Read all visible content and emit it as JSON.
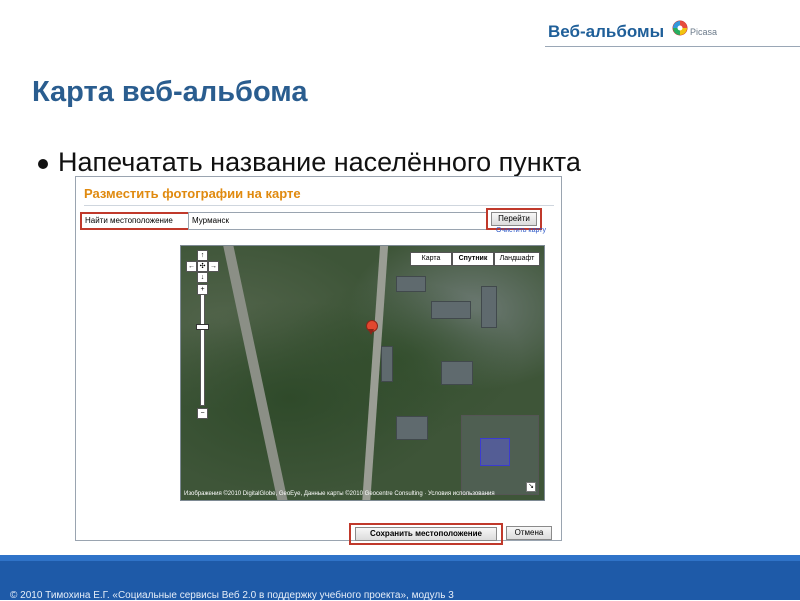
{
  "header": {
    "brand": "Веб-альбомы",
    "brand_logo_text": "Picasa",
    "logo_icon": "picasa-pinwheel-icon"
  },
  "slide": {
    "title": "Карта веб-альбома",
    "bullet": "Напечатать название населённого пункта"
  },
  "dialog": {
    "title": "Разместить фотографии на карте",
    "location_label": "Найти местоположение",
    "location_value": "Мурманск",
    "go_button": "Перейти",
    "clear_link": "Очистить карту",
    "map_types": [
      "Карта",
      "Спутник",
      "Ландшафт"
    ],
    "selected_map_type": "Спутник",
    "map_attribution": "Изображения ©2010 DigitalGlobe, GeoEye, Данные карты ©2010 Geocentre Consulting · Условия использования",
    "save_button": "Сохранить местоположение",
    "cancel_button": "Отмена"
  },
  "footer": {
    "text": "© 2010 Тимохина Е.Г. «Социальные сервисы Веб 2.0 в поддержку учебного проекта», модуль 3",
    "colors": {
      "band": "#1e5aa8",
      "strip": "#2f73c8"
    }
  },
  "colors": {
    "title": "#2a5d8f",
    "brand": "#1f5f99",
    "dialog_title": "#e08a0f",
    "highlight_border": "#c0392b"
  }
}
